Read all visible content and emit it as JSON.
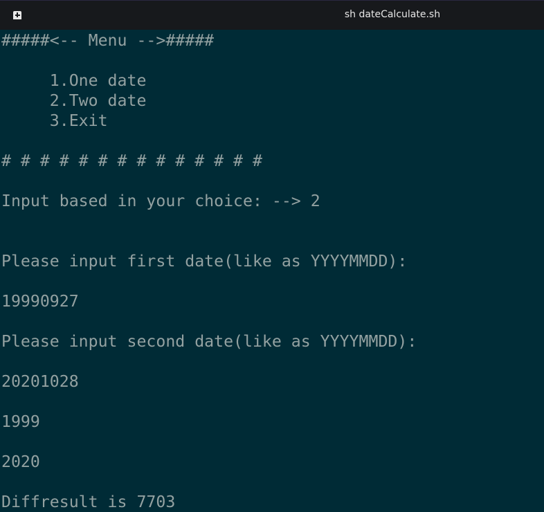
{
  "window": {
    "title": "sh dateCalculate.sh",
    "icon": "terminal-icon"
  },
  "terminal": {
    "lines": [
      "#####<-- Menu -->#####",
      "",
      "     1.One date",
      "     2.Two date",
      "     3.Exit",
      "",
      "# # # # # # # # # # # # # #",
      "",
      "Input based in your choice: --> 2",
      "",
      "",
      "Please input first date(like as YYYYMMDD):",
      "",
      "19990927",
      "",
      "Please input second date(like as YYYYMMDD):",
      "",
      "20201028",
      "",
      "1999",
      "",
      "2020",
      "",
      "Diffresult is 7703"
    ]
  },
  "colors": {
    "background": "#002b36",
    "text": "#93a1a1",
    "titlebar": "#17191c"
  }
}
